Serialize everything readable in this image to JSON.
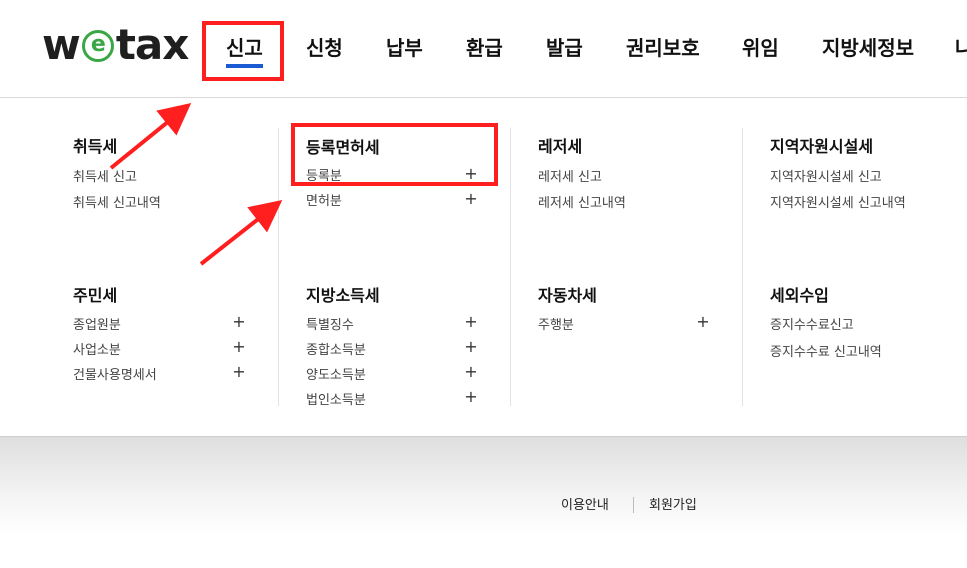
{
  "logo": {
    "w": "w",
    "e": "e",
    "rest": "tax"
  },
  "nav": [
    "신고",
    "신청",
    "납부",
    "환급",
    "발급",
    "권리보호",
    "위임",
    "지방세정보",
    "나"
  ],
  "menu": {
    "col1": {
      "sec1": {
        "title": "취득세",
        "items": [
          "취득세 신고",
          "취득세 신고내역"
        ]
      },
      "sec2": {
        "title": "주민세",
        "items": [
          "종업원분",
          "사업소분",
          "건물사용명세서"
        ]
      }
    },
    "col2": {
      "sec1": {
        "title": "등록면허세",
        "items": [
          "등록분",
          "면허분"
        ]
      },
      "sec2": {
        "title": "지방소득세",
        "items": [
          "특별징수",
          "종합소득분",
          "양도소득분",
          "법인소득분"
        ]
      }
    },
    "col3": {
      "sec1": {
        "title": "레저세",
        "items": [
          "레저세 신고",
          "레저세 신고내역"
        ]
      },
      "sec2": {
        "title": "자동차세",
        "items": [
          "주행분"
        ]
      }
    },
    "col4": {
      "sec1": {
        "title": "지역자원시설세",
        "items": [
          "지역자원시설세 신고",
          "지역자원시설세 신고내역"
        ]
      },
      "sec2": {
        "title": "세외수입",
        "items": [
          "증지수수료신고",
          "증지수수료 신고내역"
        ]
      }
    }
  },
  "plus_symbol": "+",
  "footer": {
    "links": [
      "이용안내",
      "회원가입"
    ]
  },
  "colors": {
    "annotation": "#ff1f1f",
    "active_underline": "#1a5bd3",
    "logo_e": "#3aa646"
  }
}
